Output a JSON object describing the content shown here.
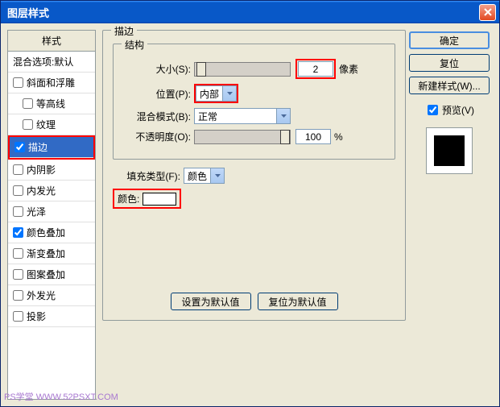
{
  "title": "图层样式",
  "left": {
    "header": "样式",
    "blend_default": "混合选项:默认",
    "items": [
      {
        "label": "斜面和浮雕",
        "checked": false,
        "indent": false
      },
      {
        "label": "等高线",
        "checked": false,
        "indent": true
      },
      {
        "label": "纹理",
        "checked": false,
        "indent": true
      },
      {
        "label": "描边",
        "checked": true,
        "indent": false,
        "selected": true,
        "highlight": true
      },
      {
        "label": "内阴影",
        "checked": false,
        "indent": false
      },
      {
        "label": "内发光",
        "checked": false,
        "indent": false
      },
      {
        "label": "光泽",
        "checked": false,
        "indent": false
      },
      {
        "label": "颜色叠加",
        "checked": true,
        "indent": false
      },
      {
        "label": "渐变叠加",
        "checked": false,
        "indent": false
      },
      {
        "label": "图案叠加",
        "checked": false,
        "indent": false
      },
      {
        "label": "外发光",
        "checked": false,
        "indent": false
      },
      {
        "label": "投影",
        "checked": false,
        "indent": false
      }
    ]
  },
  "mid": {
    "stroke_title": "描边",
    "struct_title": "结构",
    "size_label": "大小(S):",
    "size_value": "2",
    "size_unit": "像素",
    "pos_label": "位置(P):",
    "pos_value": "内部",
    "blend_label": "混合模式(B):",
    "blend_value": "正常",
    "opacity_label": "不透明度(O):",
    "opacity_value": "100",
    "opacity_unit": "%",
    "fill_label": "填充类型(F):",
    "fill_value": "颜色",
    "color_label": "颜色:",
    "default_btn": "设置为默认值",
    "reset_btn": "复位为默认值"
  },
  "right": {
    "ok": "确定",
    "reset": "复位",
    "newstyle": "新建样式(W)...",
    "preview": "预览(V)"
  },
  "watermark": "PS学堂 WWW.52PSXT.COM"
}
